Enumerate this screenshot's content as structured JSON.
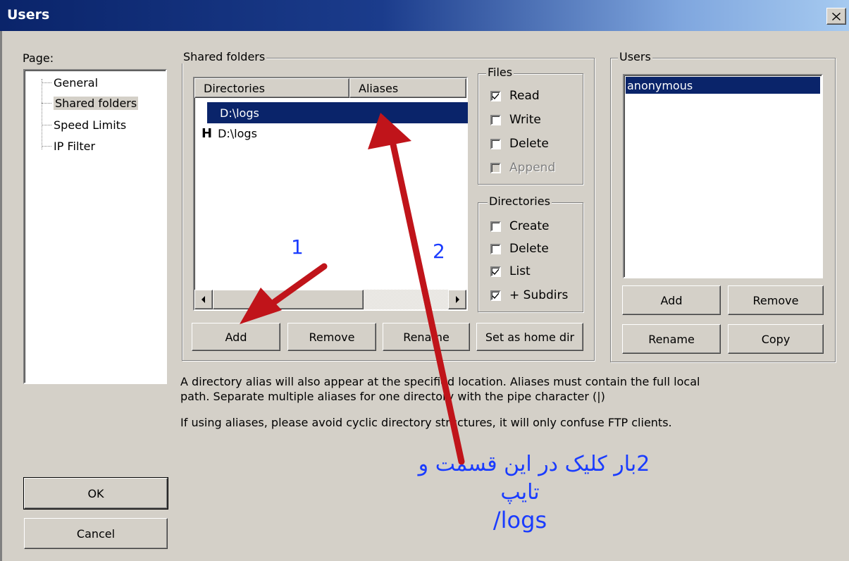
{
  "window": {
    "title": "Users",
    "close_glyph": "✕"
  },
  "page_panel": {
    "label": "Page:",
    "items": [
      "General",
      "Shared folders",
      "Speed Limits",
      "IP Filter"
    ],
    "selected_index": 1
  },
  "shared_folders": {
    "group_label": "Shared folders",
    "columns": [
      "Directories",
      "Aliases"
    ],
    "rows": [
      {
        "marker": "",
        "directory": "D:\\logs",
        "selected": true
      },
      {
        "marker": "H",
        "directory": "D:\\logs",
        "selected": false
      }
    ],
    "buttons": {
      "add": "Add",
      "remove": "Remove",
      "rename": "Rename",
      "set_home": "Set as home dir"
    }
  },
  "files_group": {
    "label": "Files",
    "items": [
      {
        "label": "Read",
        "checked": true,
        "enabled": true
      },
      {
        "label": "Write",
        "checked": false,
        "enabled": true
      },
      {
        "label": "Delete",
        "checked": false,
        "enabled": true
      },
      {
        "label": "Append",
        "checked": false,
        "enabled": false
      }
    ]
  },
  "directories_group": {
    "label": "Directories",
    "items": [
      {
        "label": "Create",
        "checked": false
      },
      {
        "label": "Delete",
        "checked": false
      },
      {
        "label": "List",
        "checked": true
      },
      {
        "label": "+ Subdirs",
        "checked": true
      }
    ]
  },
  "users_group": {
    "label": "Users",
    "list": [
      "anonymous"
    ],
    "selected_index": 0,
    "buttons": {
      "add": "Add",
      "remove": "Remove",
      "rename": "Rename",
      "copy": "Copy"
    }
  },
  "notes": {
    "line1": "A directory alias will also appear at the specified location. Aliases must contain the full local",
    "line2": "path. Separate multiple aliases for one directory with the pipe character (|)",
    "line3": "If using aliases, please avoid cyclic directory structures, it will only confuse FTP clients."
  },
  "dialog_buttons": {
    "ok": "OK",
    "cancel": "Cancel"
  },
  "annotations": {
    "step1": "1",
    "step2": "2",
    "instruction_line1": "2بار کلیک در این قسمت و",
    "instruction_line2": "تایپ",
    "instruction_line3": "/logs",
    "arrow_color": "#c0141a",
    "text_color": "#1a3cff"
  },
  "colors": {
    "selection": "#0a246a",
    "face": "#d4d0c8"
  }
}
